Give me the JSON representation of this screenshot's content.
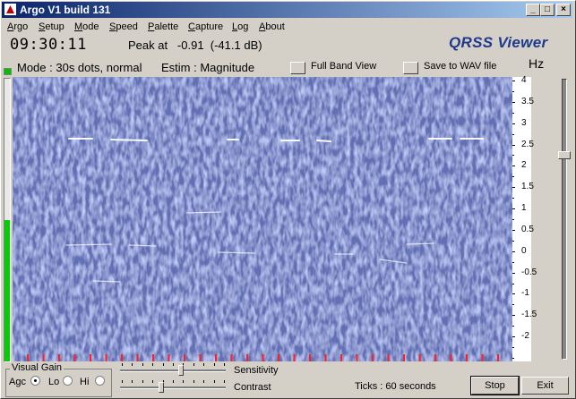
{
  "window": {
    "title": "Argo V1 build 131"
  },
  "menu": [
    "Argo",
    "Setup",
    "Mode",
    "Speed",
    "Palette",
    "Capture",
    "Log",
    "About"
  ],
  "header": {
    "time": "09:30:11",
    "peak": "Peak at   -0.91  (-41.1 dB)",
    "brand": "QRSS Viewer",
    "mode": "Mode : 30s dots, normal",
    "estim": "Estim : Magnitude",
    "full_band_label": "Full Band View",
    "save_wav_label": "Save to WAV file",
    "units": "Hz"
  },
  "scale": {
    "labels": [
      "4",
      "3.5",
      "3",
      "2.5",
      "2",
      "1.5",
      "1",
      "0.5",
      "0",
      "-0.5",
      "-1",
      "-1.5",
      "-2"
    ],
    "max": 4,
    "min": -2.5
  },
  "level": {
    "fraction": 0.5
  },
  "visual_gain": {
    "title": "Visual Gain",
    "agc": "Agc",
    "lo": "Lo",
    "hi": "Hi",
    "selected": "Agc"
  },
  "sliders": {
    "sensitivity_label": "Sensitivity",
    "contrast_label": "Contrast",
    "sensitivity_value": 0.58,
    "contrast_value": 0.38
  },
  "footer": {
    "ticks": "Ticks  : 60 seconds",
    "stop": "Stop",
    "exit": "Exit"
  },
  "colors": {
    "spectrogram_bg": "#1c2a70",
    "trace": "#ffffff",
    "tick_marks": "#ff2020",
    "brand": "#1f3a8a",
    "level": "#00d000"
  }
}
